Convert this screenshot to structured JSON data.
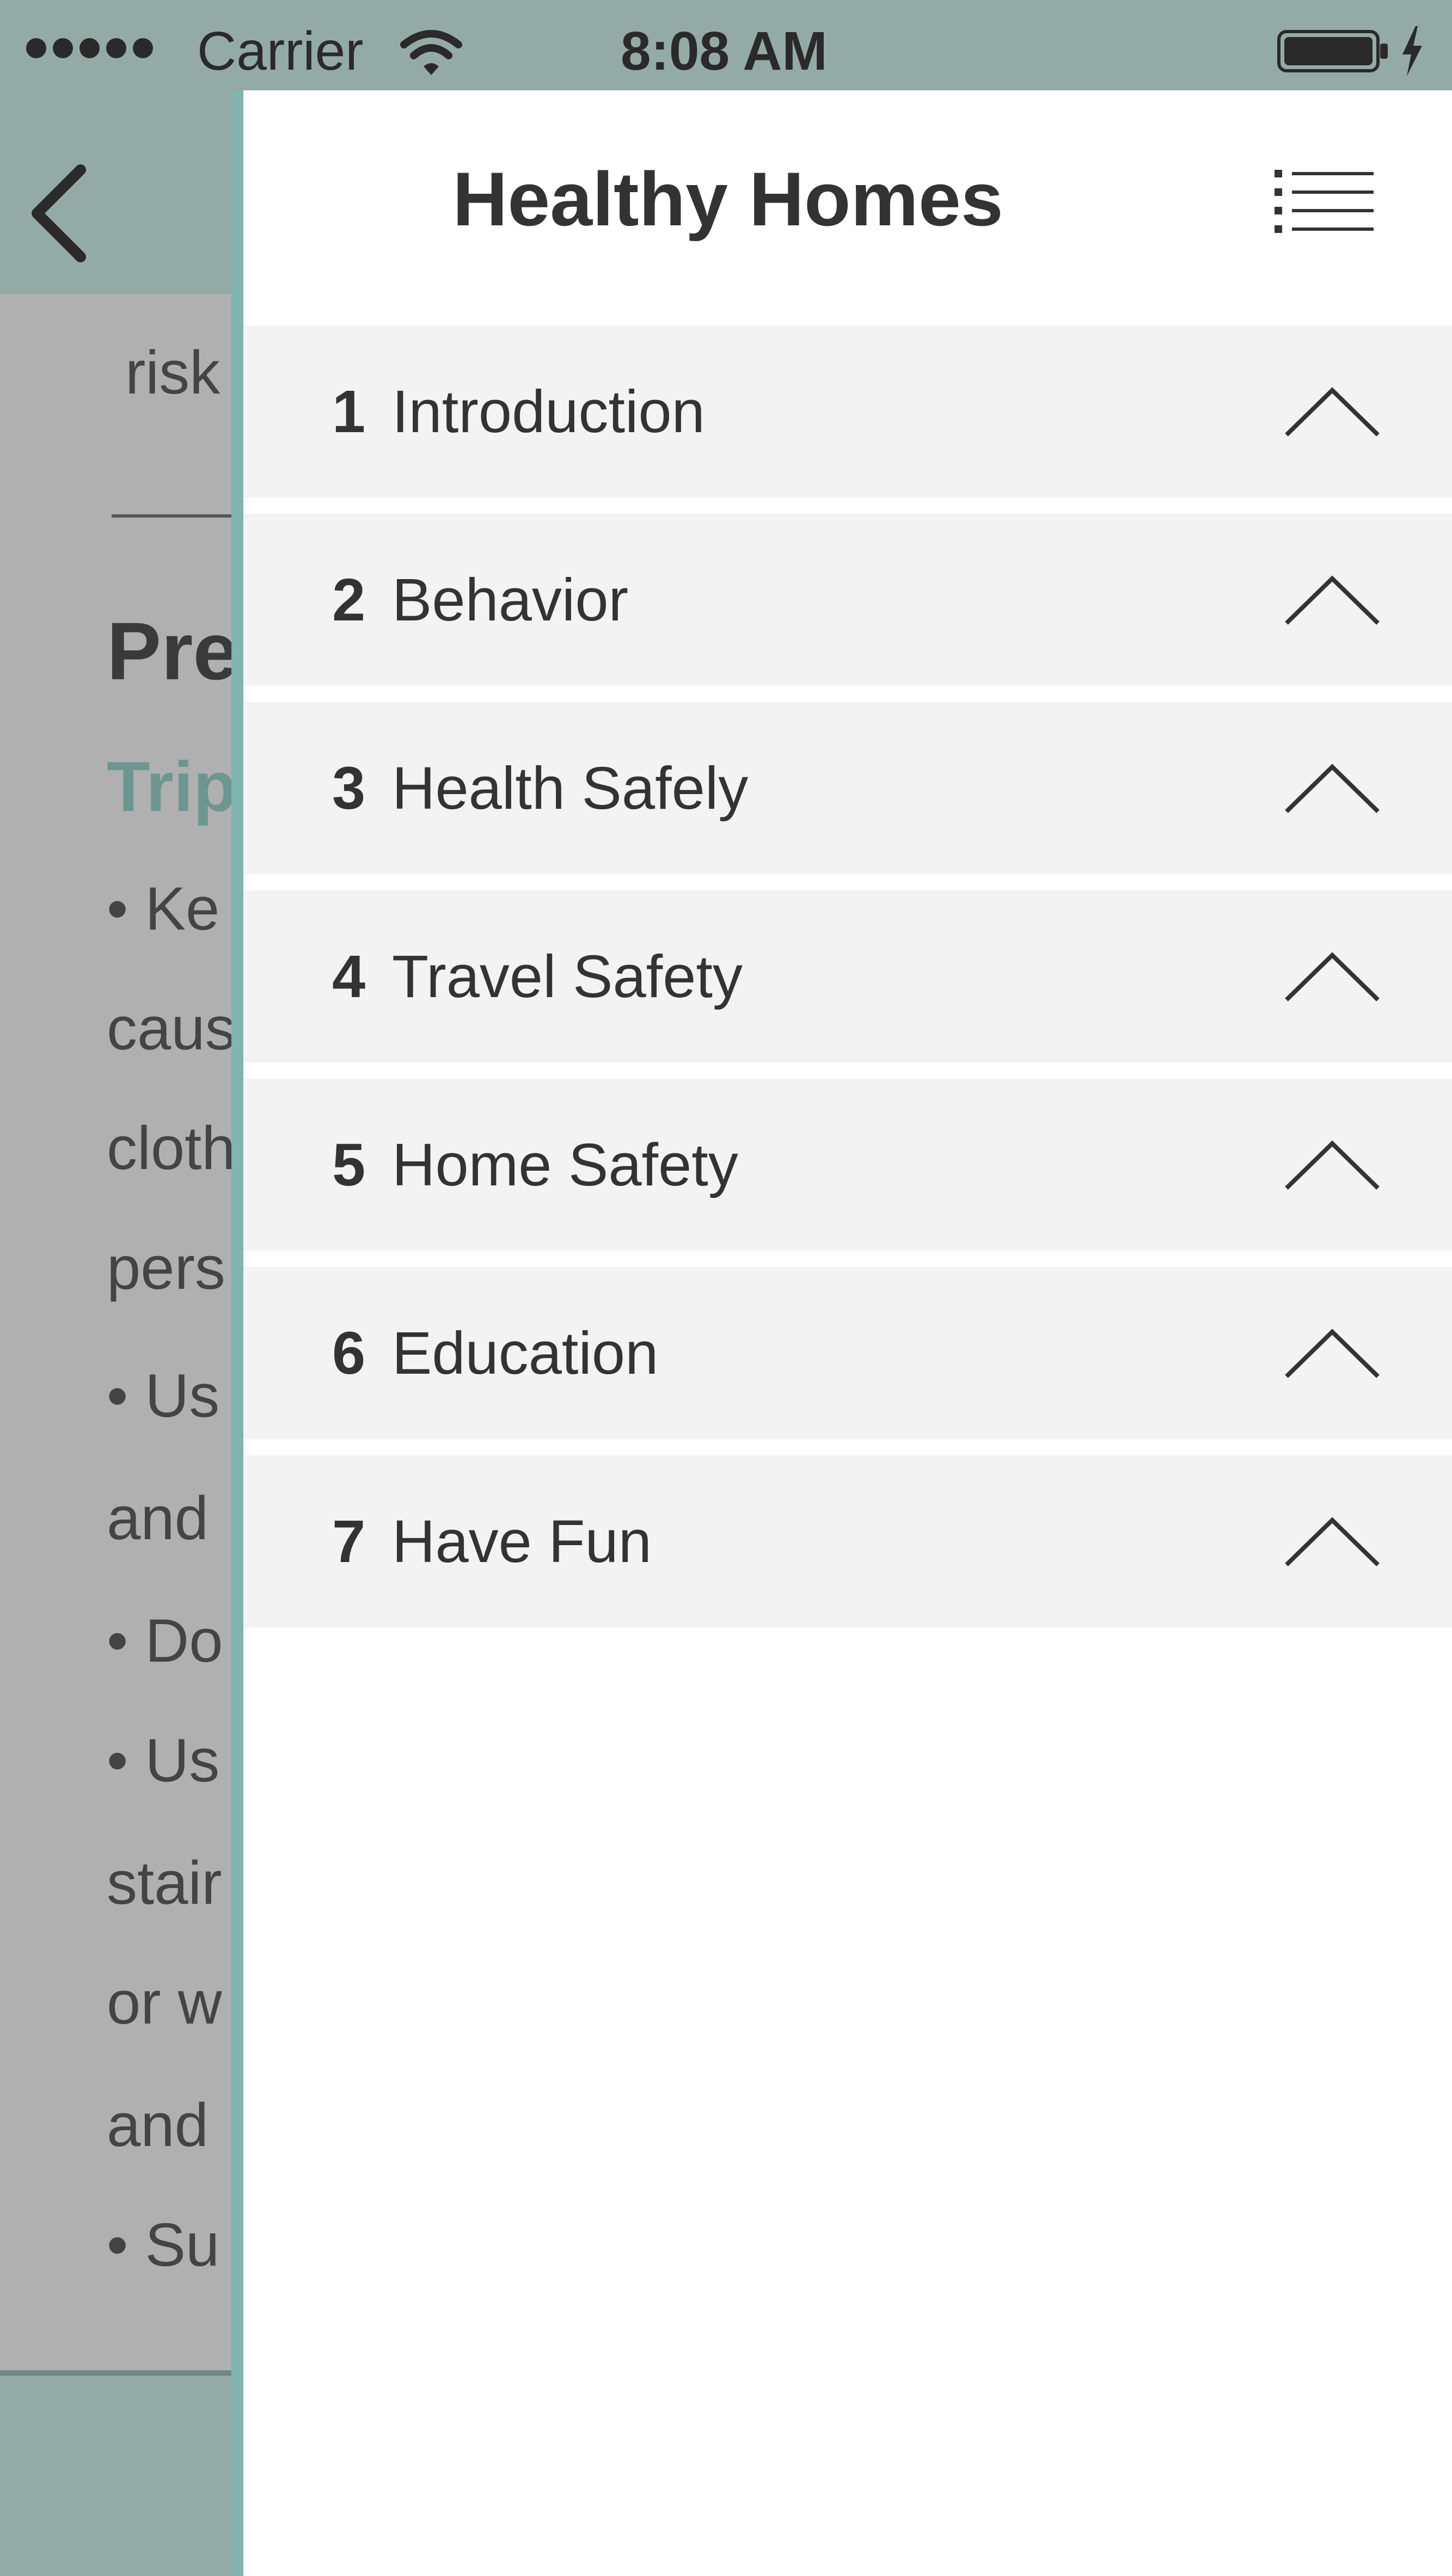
{
  "status_bar": {
    "carrier": "Carrier",
    "time": "8:08 AM"
  },
  "background_page": {
    "lines": [
      "risk",
      "Pre",
      "Trip",
      "• Ke",
      "caus",
      "cloth",
      "pers",
      "• Us",
      "and",
      "• Do",
      "• Us",
      "stair",
      "or w",
      "and",
      "• Su"
    ]
  },
  "drawer": {
    "title": "Healthy Homes",
    "items": [
      {
        "number": "1",
        "label": "Introduction"
      },
      {
        "number": "2",
        "label": "Behavior"
      },
      {
        "number": "3",
        "label": "Health Safely"
      },
      {
        "number": "4",
        "label": "Travel Safety"
      },
      {
        "number": "5",
        "label": "Home Safety"
      },
      {
        "number": "6",
        "label": "Education"
      },
      {
        "number": "7",
        "label": "Have Fun"
      }
    ]
  },
  "colors": {
    "status_bar": "#94aaa6",
    "accent_teal": "#7fb5ae",
    "dim_overlay": "#b0b0b0",
    "menu_item_bg": "#f3f3f3",
    "text_dark": "#333333"
  }
}
